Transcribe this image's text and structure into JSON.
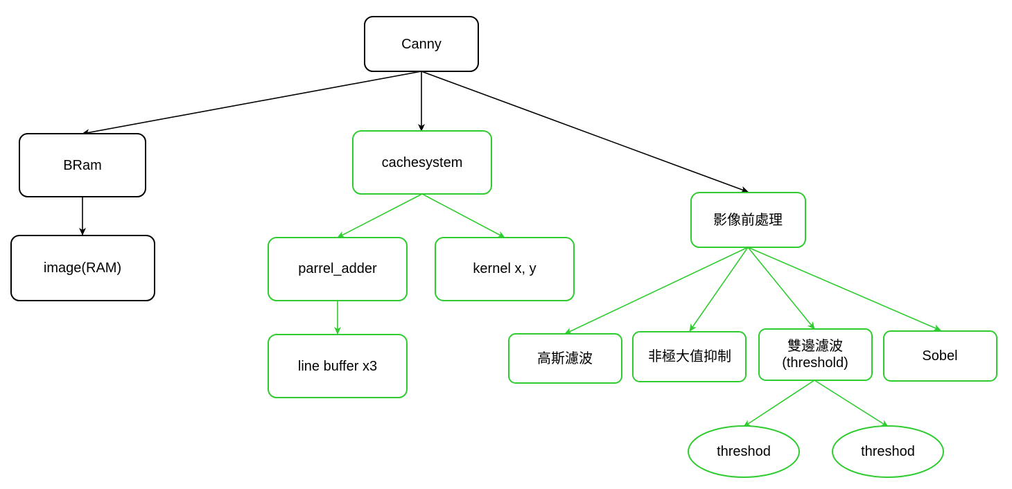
{
  "colors": {
    "black": "#000000",
    "green": "#2ecc2e",
    "background": "#ffffff"
  },
  "nodes": {
    "canny": "Canny",
    "bram": "BRam",
    "image_ram": "image(RAM)",
    "cachesystem": "cachesystem",
    "parrel_adder": "parrel_adder",
    "line_buffer": "line buffer x3",
    "kernel": "kernel x, y",
    "preprocess": "影像前處理",
    "gaussian": "高斯濾波",
    "nms": "非極大值抑制",
    "double_edge_line1": "雙邊濾波",
    "double_edge_line2": "(threshold)",
    "sobel": "Sobel",
    "threshod_left": "threshod",
    "threshod_right": "threshod"
  }
}
